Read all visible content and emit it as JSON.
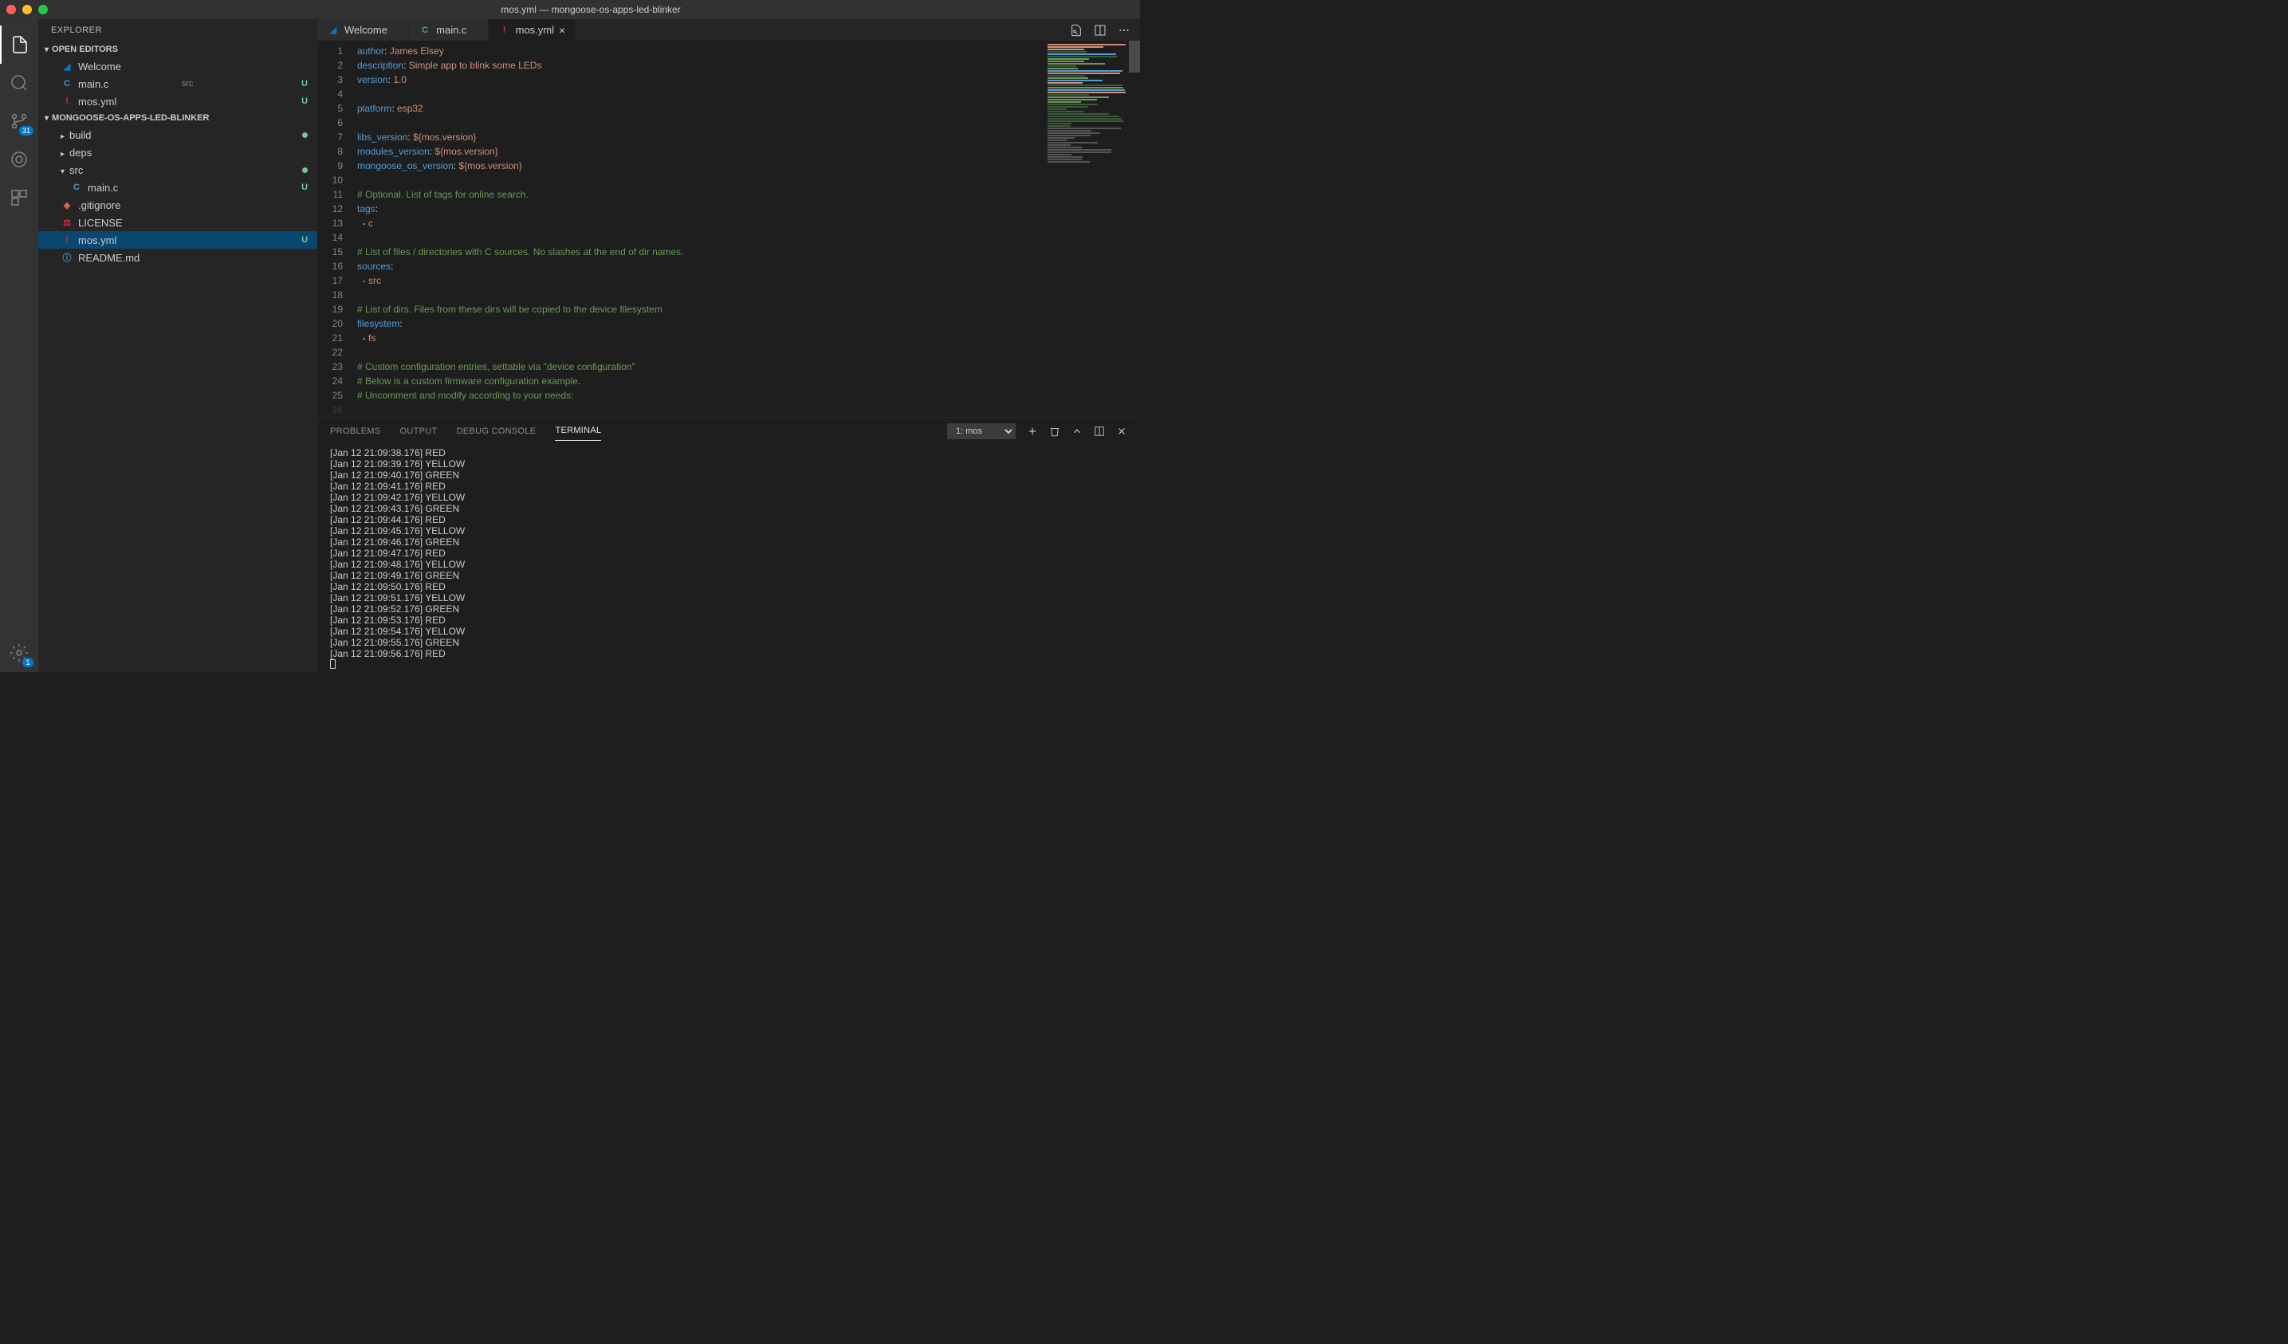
{
  "titlebar": {
    "title": "mos.yml — mongoose-os-apps-led-blinker"
  },
  "sidebar": {
    "title": "EXPLORER",
    "openEditors": {
      "header": "OPEN EDITORS",
      "items": [
        {
          "icon": "vs",
          "label": "Welcome",
          "status": ""
        },
        {
          "icon": "c",
          "label": "main.c",
          "sub": "src",
          "status": "U"
        },
        {
          "icon": "yml",
          "label": "mos.yml",
          "status": "U"
        }
      ]
    },
    "project": {
      "header": "MONGOOSE-OS-APPS-LED-BLINKER",
      "items": [
        {
          "type": "folder",
          "open": false,
          "label": "build",
          "untracked": true
        },
        {
          "type": "folder",
          "open": false,
          "label": "deps"
        },
        {
          "type": "folder",
          "open": true,
          "label": "src",
          "untracked": true
        },
        {
          "type": "file",
          "indent": 2,
          "icon": "c",
          "label": "main.c",
          "status": "U"
        },
        {
          "type": "file",
          "indent": 1,
          "icon": "git",
          "label": ".gitignore"
        },
        {
          "type": "file",
          "indent": 1,
          "icon": "lic",
          "label": "LICENSE"
        },
        {
          "type": "file",
          "indent": 1,
          "icon": "yml",
          "label": "mos.yml",
          "status": "U",
          "selected": true
        },
        {
          "type": "file",
          "indent": 1,
          "icon": "info",
          "label": "README.md"
        }
      ]
    }
  },
  "activity": {
    "scmBadge": "31",
    "settingsBadge": "1"
  },
  "tabs": [
    {
      "icon": "vs",
      "label": "Welcome",
      "active": false
    },
    {
      "icon": "c",
      "label": "main.c",
      "active": false
    },
    {
      "icon": "yml",
      "label": "mos.yml",
      "active": true
    }
  ],
  "editor": {
    "lines": [
      [
        {
          "t": "key",
          "v": "author"
        },
        {
          "t": "pun",
          "v": ":"
        },
        {
          "t": "str",
          "v": " James Elsey"
        }
      ],
      [
        {
          "t": "key",
          "v": "description"
        },
        {
          "t": "pun",
          "v": ":"
        },
        {
          "t": "str",
          "v": " Simple app to blink some LEDs"
        }
      ],
      [
        {
          "t": "key",
          "v": "version"
        },
        {
          "t": "pun",
          "v": ":"
        },
        {
          "t": "str",
          "v": " 1.0"
        }
      ],
      [],
      [
        {
          "t": "key",
          "v": "platform"
        },
        {
          "t": "pun",
          "v": ":"
        },
        {
          "t": "str",
          "v": " esp32"
        }
      ],
      [],
      [
        {
          "t": "key",
          "v": "libs_version"
        },
        {
          "t": "pun",
          "v": ":"
        },
        {
          "t": "str",
          "v": " ${mos.version}"
        }
      ],
      [
        {
          "t": "key",
          "v": "modules_version"
        },
        {
          "t": "pun",
          "v": ":"
        },
        {
          "t": "str",
          "v": " ${mos.version}"
        }
      ],
      [
        {
          "t": "key",
          "v": "mongoose_os_version"
        },
        {
          "t": "pun",
          "v": ":"
        },
        {
          "t": "str",
          "v": " ${mos.version}"
        }
      ],
      [],
      [
        {
          "t": "cmt",
          "v": "# Optional. List of tags for online search."
        }
      ],
      [
        {
          "t": "key",
          "v": "tags"
        },
        {
          "t": "pun",
          "v": ":"
        }
      ],
      [
        {
          "t": "seq",
          "v": "  - "
        },
        {
          "t": "str",
          "v": "c"
        }
      ],
      [],
      [
        {
          "t": "cmt",
          "v": "# List of files / directories with C sources. No slashes at the end of dir names."
        }
      ],
      [
        {
          "t": "key",
          "v": "sources"
        },
        {
          "t": "pun",
          "v": ":"
        }
      ],
      [
        {
          "t": "seq",
          "v": "  - "
        },
        {
          "t": "str",
          "v": "src"
        }
      ],
      [],
      [
        {
          "t": "cmt",
          "v": "# List of dirs. Files from these dirs will be copied to the device filesystem"
        }
      ],
      [
        {
          "t": "key",
          "v": "filesystem"
        },
        {
          "t": "pun",
          "v": ":"
        }
      ],
      [
        {
          "t": "seq",
          "v": "  - "
        },
        {
          "t": "str",
          "v": "fs"
        }
      ],
      [],
      [
        {
          "t": "cmt",
          "v": "# Custom configuration entries, settable via \"device configuration\""
        }
      ],
      [
        {
          "t": "cmt",
          "v": "# Below is a custom firmware configuration example."
        }
      ],
      [
        {
          "t": "cmt",
          "v": "# Uncomment and modify according to your needs:"
        }
      ]
    ]
  },
  "panel": {
    "tabs": {
      "problems": "PROBLEMS",
      "output": "OUTPUT",
      "debug": "DEBUG CONSOLE",
      "terminal": "TERMINAL"
    },
    "termSelect": "1: mos",
    "terminalLines": [
      "[Jan 12 21:09:38.176] RED",
      "[Jan 12 21:09:39.176] YELLOW",
      "[Jan 12 21:09:40.176] GREEN",
      "[Jan 12 21:09:41.176] RED",
      "[Jan 12 21:09:42.176] YELLOW",
      "[Jan 12 21:09:43.176] GREEN",
      "[Jan 12 21:09:44.176] RED",
      "[Jan 12 21:09:45.176] YELLOW",
      "[Jan 12 21:09:46.176] GREEN",
      "[Jan 12 21:09:47.176] RED",
      "[Jan 12 21:09:48.176] YELLOW",
      "[Jan 12 21:09:49.176] GREEN",
      "[Jan 12 21:09:50.176] RED",
      "[Jan 12 21:09:51.176] YELLOW",
      "[Jan 12 21:09:52.176] GREEN",
      "[Jan 12 21:09:53.176] RED",
      "[Jan 12 21:09:54.176] YELLOW",
      "[Jan 12 21:09:55.176] GREEN",
      "[Jan 12 21:09:56.176] RED"
    ]
  }
}
